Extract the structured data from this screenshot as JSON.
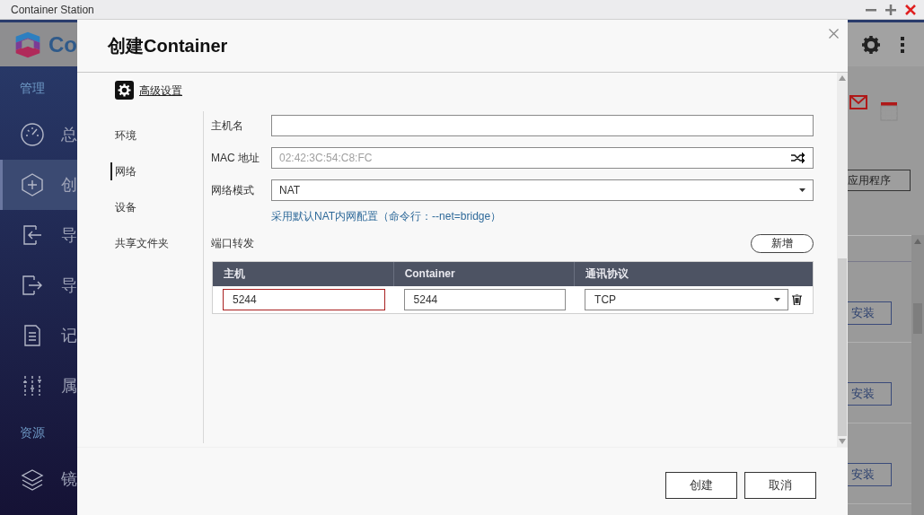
{
  "window": {
    "title": "Container Station"
  },
  "background_app": {
    "logo_text": "Co",
    "sidebar": [
      {
        "heading": "管理",
        "items": [
          {
            "label": "总",
            "kind": "dashboard",
            "selected": false
          },
          {
            "label": "创",
            "kind": "create",
            "selected": true
          },
          {
            "label": "导",
            "kind": "import",
            "selected": false
          },
          {
            "label": "导",
            "kind": "export",
            "selected": false
          },
          {
            "label": "记",
            "kind": "log",
            "selected": false
          },
          {
            "label": "属",
            "kind": "properties",
            "selected": false
          }
        ]
      },
      {
        "heading": "资源",
        "items": [
          {
            "label": "镜",
            "kind": "images",
            "selected": false
          }
        ]
      }
    ],
    "app_button": "应用程序",
    "install_buttons": [
      "安装",
      "安装",
      "安装"
    ]
  },
  "dialog": {
    "title": "创建Container",
    "advanced_link": "高级设置",
    "nav": [
      {
        "label": "环境",
        "selected": false
      },
      {
        "label": "网络",
        "selected": true
      },
      {
        "label": "设备",
        "selected": false
      },
      {
        "label": "共享文件夹",
        "selected": false
      }
    ],
    "fields": [
      {
        "label": "主机名",
        "kind": "text"
      },
      {
        "label": "MAC 地址",
        "kind": "generated",
        "placeholder": "02:42:3C:54:C8:FC"
      },
      {
        "label": "网络模式",
        "kind": "select",
        "value": "NAT"
      }
    ],
    "network_hint": "采用默认NAT内网配置（命令行：--net=bridge）",
    "port_forwarding": {
      "label": "端口转发",
      "add_button": "新增",
      "columns": [
        "主机",
        "Container",
        "通讯协议"
      ],
      "rows": [
        {
          "host": "5244",
          "host_invalid": true,
          "container": "5244",
          "protocol": "TCP"
        }
      ]
    },
    "buttons": [
      "创建",
      "取消"
    ]
  }
}
